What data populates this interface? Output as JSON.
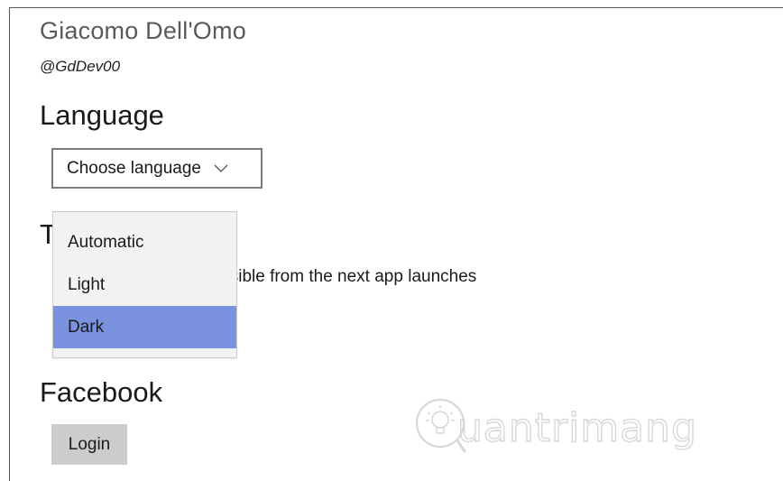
{
  "author": {
    "name": "Giacomo Dell'Omo",
    "handle": "@GdDev00"
  },
  "language": {
    "heading": "Language",
    "select_label": "Choose language"
  },
  "theme": {
    "heading_visible": "T",
    "note_visible": "visible from the next app launches",
    "options": [
      "Automatic",
      "Light",
      "Dark"
    ],
    "highlighted_option": "Dark",
    "highlight_color": "#7b93df"
  },
  "facebook": {
    "heading": "Facebook",
    "login_label": "Login"
  },
  "watermark": {
    "brand": "uantrimang"
  },
  "icons": {
    "select_chevron": "chevron-down-icon",
    "watermark_logo": "lightbulb-q-logo"
  }
}
